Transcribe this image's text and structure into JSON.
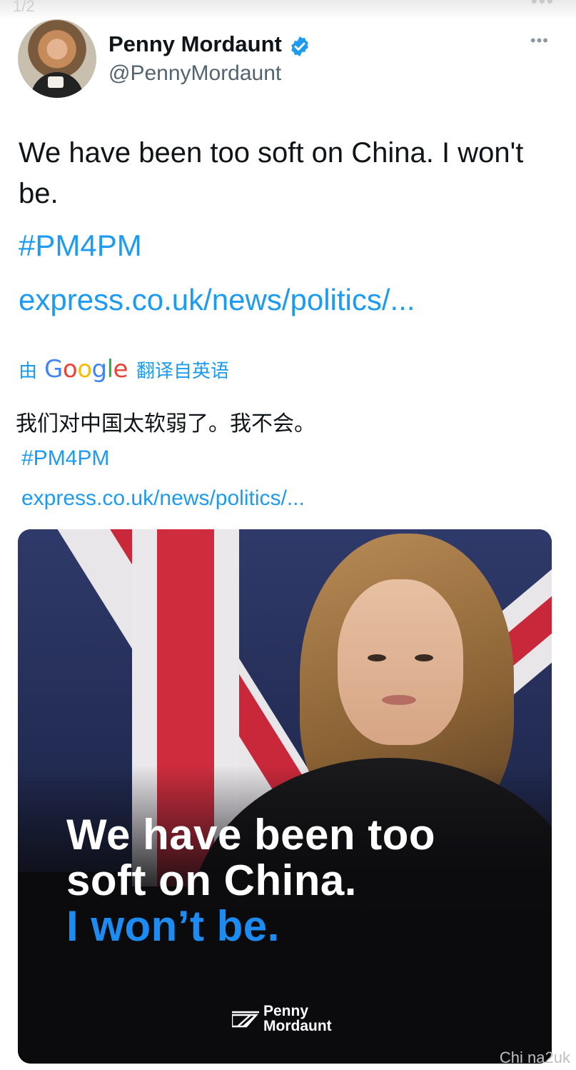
{
  "viewer": {
    "page_indicator": "1/2",
    "top_menu": "•••"
  },
  "tweet": {
    "display_name": "Penny Mordaunt",
    "handle": "@PennyMordaunt",
    "more_menu": "•••",
    "text": "We have been too soft on China. I won't be.",
    "hashtag": "#PM4PM",
    "link": "express.co.uk/news/politics/...",
    "translation": {
      "prefix": "由",
      "provider_letters": [
        "G",
        "o",
        "o",
        "g",
        "l",
        "e"
      ],
      "provider_colors": [
        "#4285F4",
        "#EA4335",
        "#FBBC05",
        "#4285F4",
        "#34A853",
        "#EA4335"
      ],
      "suffix": "翻译自英语",
      "text": "我们对中国太软弱了。我不会。",
      "hashtag": "#PM4PM",
      "link": "express.co.uk/news/politics/..."
    },
    "media": {
      "headline_line1": "We have been too",
      "headline_line2": "soft on China.",
      "headline_line3": "I won’t be.",
      "brand_line1": "Penny",
      "brand_line2": "Mordaunt",
      "accent_color": "#1d8cf2"
    }
  },
  "watermark": "Chi na2uk",
  "colors": {
    "link_blue": "#1d9bf0",
    "verified_blue": "#1d9bf0",
    "text_primary": "#0f1419",
    "text_secondary": "#536471"
  }
}
